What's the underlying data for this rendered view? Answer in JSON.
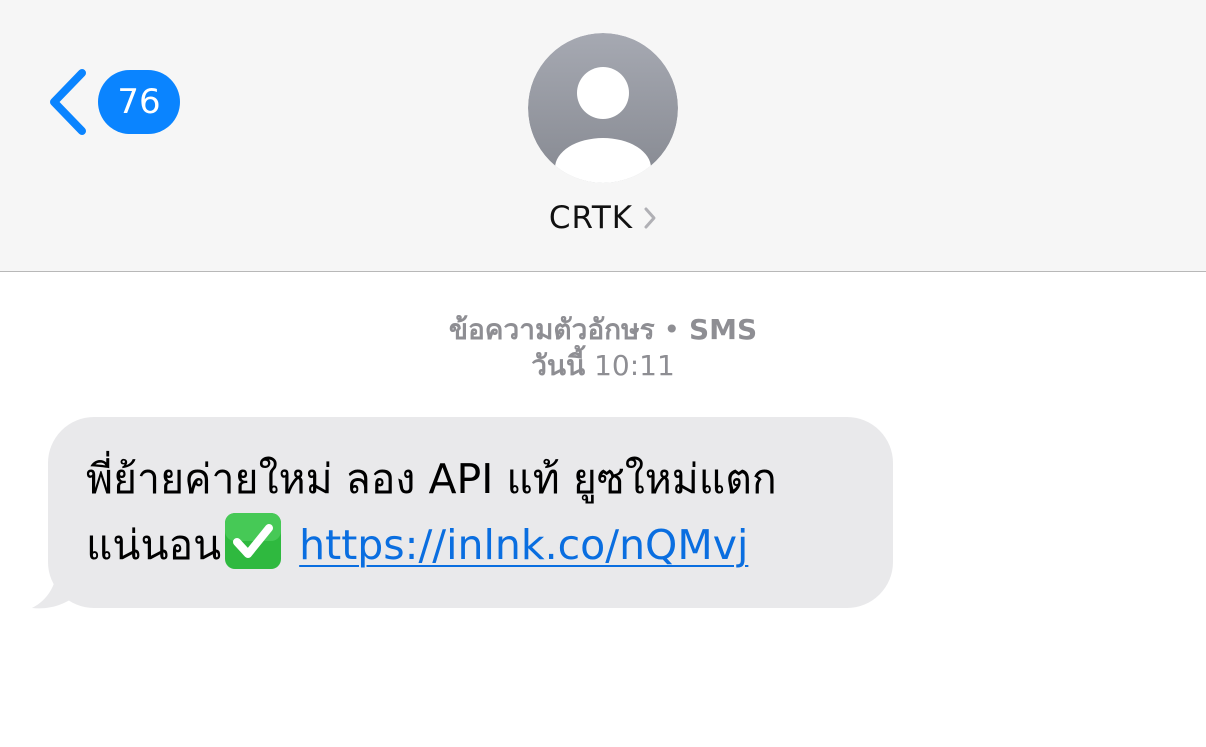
{
  "header": {
    "back_count": "76",
    "contact_name": "CRTK",
    "accent_color": "#0a84ff"
  },
  "conversation": {
    "service_label": "ข้อความตัวอักษร",
    "service_separator": "•",
    "service_type": "SMS",
    "day_label": "วันนี้",
    "time": "10:11"
  },
  "message": {
    "text_line1": "พี่ย้ายค่ายใหม่ ลอง API แท้ ยูซใหม่แตก",
    "text_line2": "แน่นอน",
    "emoji_icon": "check-mark-button-icon",
    "link": "https://inlnk.co/nQMvj",
    "link_color": "#0a6ee0",
    "bubble_color": "#e9e9eb"
  }
}
